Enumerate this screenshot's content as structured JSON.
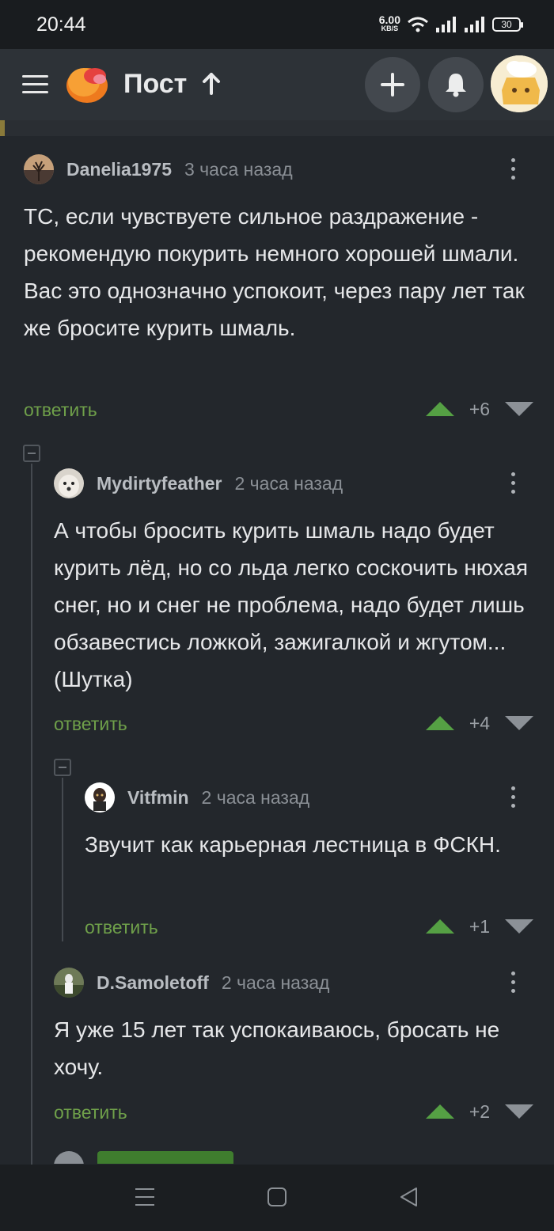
{
  "status_bar": {
    "time": "20:44",
    "net_speed_value": "6.00",
    "net_speed_unit": "KB/S",
    "battery": "30",
    "icons": [
      "wifi-icon",
      "signal-icon",
      "signal-icon",
      "battery-icon"
    ]
  },
  "header": {
    "title": "Пост",
    "icons": [
      "menu-icon",
      "logo-icon",
      "arrow-up-icon",
      "plus-icon",
      "bell-icon",
      "user-avatar"
    ]
  },
  "colors": {
    "background": "#23272c",
    "header": "#2d3237",
    "reply_link": "#6fa04a",
    "upvote": "#55a044",
    "downvote": "#8c9197"
  },
  "comments": [
    {
      "user": "Danelia1975",
      "time": "3 часа назад",
      "text": "ТС, если чувствуете сильное раздражение - рекомендую покурить немного хорошей шмали. Вас это однозначно успокоит, через пару лет так же бросите курить шмаль.",
      "reply": "ответить",
      "score": "+6"
    },
    {
      "user": "Mydirtyfeather",
      "time": "2 часа назад",
      "text": "А чтобы бросить курить шмаль надо будет курить лёд, но со льда легко соскочить нюхая снег, но и снег не проблема, надо будет лишь обзавестись ложкой, зажигалкой и жгутом... (Шутка)",
      "reply": "ответить",
      "score": "+4"
    },
    {
      "user": "Vitfmin",
      "time": "2 часа назад",
      "text": "Звучит как карьерная лестница в ФСКН.",
      "reply": "ответить",
      "score": "+1"
    },
    {
      "user": "D.Samoletoff",
      "time": "2 часа назад",
      "text": "Я уже 15 лет так успокаиваюсь, бросать не хочу.",
      "reply": "ответить",
      "score": "+2"
    }
  ],
  "bottom_nav": {
    "icons": [
      "recent-apps-icon",
      "home-icon",
      "back-icon"
    ]
  }
}
